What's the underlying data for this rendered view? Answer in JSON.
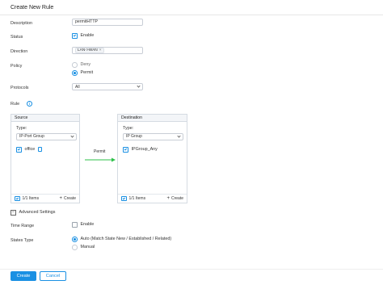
{
  "page": {
    "title": "Create New Rule"
  },
  "fields": {
    "description": {
      "label": "Description",
      "value": "permitHTTP"
    },
    "status": {
      "label": "Status",
      "option": "Enable",
      "checked": true
    },
    "direction": {
      "label": "Direction",
      "tag": "LAN->WAN",
      "remove": "×"
    },
    "policy": {
      "label": "Policy",
      "options": [
        "Deny",
        "Permit"
      ],
      "selected": "Permit"
    },
    "protocols": {
      "label": "Protocols",
      "value": "All"
    }
  },
  "rule": {
    "label": "Rule",
    "info": "i",
    "source": {
      "heading": "Source",
      "type_label": "Type:",
      "type_value": "IP-Port Group",
      "item": "office",
      "items_count": "1/1 Items",
      "create": "Create"
    },
    "arrow_label": "Permit",
    "destination": {
      "heading": "Destination",
      "type_label": "Type:",
      "type_value": "IP Group",
      "item": "IPGroup_Any",
      "items_count": "1/1 Items",
      "create": "Create"
    }
  },
  "advanced": {
    "toggle": "−",
    "label": "Advanced Settings",
    "time_range": {
      "label": "Time Range",
      "option": "Enable",
      "checked": false
    },
    "states_type": {
      "label": "States Type",
      "options": [
        "Auto (Match State New / Established / Related)",
        "Manual"
      ],
      "selected": "Auto (Match State New / Established / Related)"
    }
  },
  "buttons": {
    "create": "Create",
    "cancel": "Cancel"
  },
  "colors": {
    "accent": "#1a90e3",
    "arrow": "#2ec14a"
  }
}
